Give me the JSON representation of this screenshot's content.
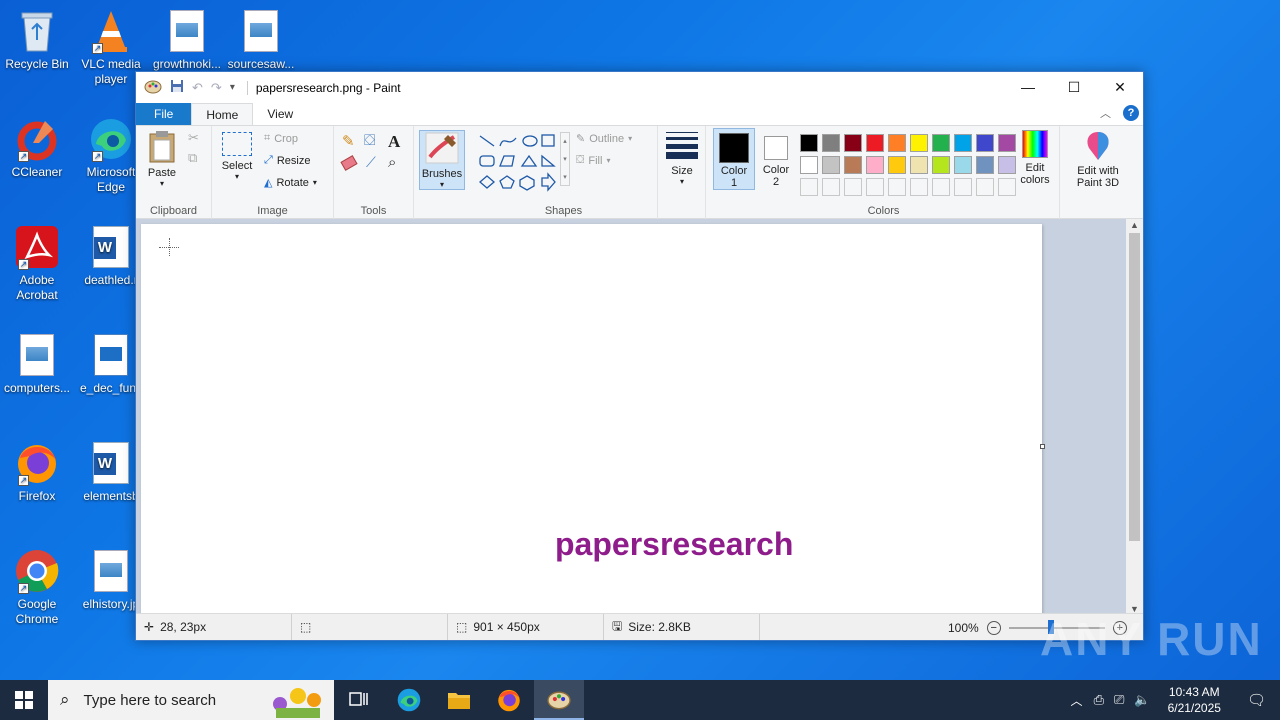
{
  "desktop": {
    "icons": [
      {
        "label": "Recycle Bin"
      },
      {
        "label": "VLC media player"
      },
      {
        "label": "growthnoki..."
      },
      {
        "label": "sourcesaw..."
      },
      {
        "label": "CCleaner"
      },
      {
        "label": "Microsoft Edge"
      },
      {
        "label": "Adobe Acrobat"
      },
      {
        "label": "deathled.r"
      },
      {
        "label": "computers..."
      },
      {
        "label": "e_dec_func"
      },
      {
        "label": "Firefox"
      },
      {
        "label": "elementsb"
      },
      {
        "label": "Google Chrome"
      },
      {
        "label": "elhistory.jp"
      }
    ]
  },
  "window": {
    "title": "papersresearch.png - Paint",
    "tabs": {
      "file": "File",
      "home": "Home",
      "view": "View"
    },
    "help": "?"
  },
  "ribbon": {
    "clipboard": {
      "group": "Clipboard",
      "paste": "Paste"
    },
    "image": {
      "group": "Image",
      "select": "Select",
      "crop": "Crop",
      "resize": "Resize",
      "rotate": "Rotate"
    },
    "tools": {
      "group": "Tools",
      "text_tool": "A"
    },
    "brushes": {
      "label": "Brushes"
    },
    "shapes": {
      "group": "Shapes",
      "outline": "Outline",
      "fill": "Fill"
    },
    "size": {
      "label": "Size"
    },
    "colors": {
      "group": "Colors",
      "color1": "Color 1",
      "color1_a": "Color",
      "color1_b": "1",
      "color2_a": "Color",
      "color2_b": "2",
      "edit_a": "Edit",
      "edit_b": "colors",
      "paint3d_a": "Edit with",
      "paint3d_b": "Paint 3D",
      "palette_row1": [
        "#000000",
        "#7f7f7f",
        "#880015",
        "#ed1c24",
        "#ff7f27",
        "#fff200",
        "#22b14c",
        "#00a2e8",
        "#3f48cc",
        "#a349a4"
      ],
      "palette_row2": [
        "#ffffff",
        "#c3c3c3",
        "#b97a57",
        "#ffaec9",
        "#ffc90e",
        "#efe4b0",
        "#b5e61d",
        "#99d9ea",
        "#7092be",
        "#c8bfe7"
      ]
    }
  },
  "canvas": {
    "text": "papersresearch",
    "text_color": "#8e1d8b"
  },
  "status": {
    "cursor": "28, 23px",
    "dimensions": "901 × 450px",
    "size": "Size: 2.8KB",
    "zoom": "100%"
  },
  "taskbar": {
    "search_placeholder": "Type here to search",
    "time": "10:43 AM",
    "date": "6/21/2025"
  },
  "watermark": "ANY RUN"
}
